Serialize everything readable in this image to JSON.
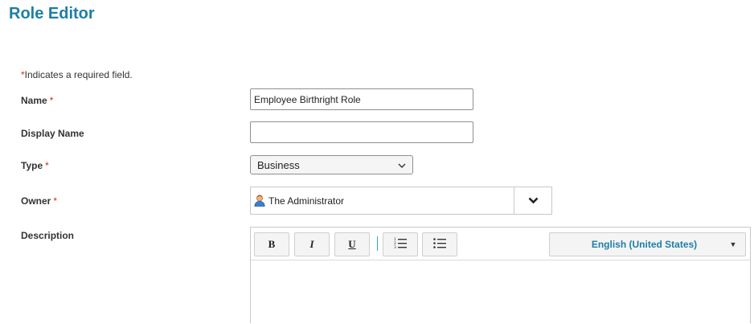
{
  "page": {
    "title": "Role Editor"
  },
  "form": {
    "required_note_star": "*",
    "required_note": "Indicates a required field.",
    "required_star": "*",
    "name": {
      "label": "Name",
      "value": "Employee Birthright Role"
    },
    "display_name": {
      "label": "Display Name",
      "value": ""
    },
    "type": {
      "label": "Type",
      "selected": "Business"
    },
    "owner": {
      "label": "Owner",
      "value": "The Administrator"
    },
    "description": {
      "label": "Description",
      "toolbar": {
        "bold": "B",
        "italic": "I",
        "underline": "U",
        "language": "English (United States)"
      },
      "value": ""
    }
  },
  "colors": {
    "accent": "#1d7ea8",
    "required": "#d9232b"
  }
}
